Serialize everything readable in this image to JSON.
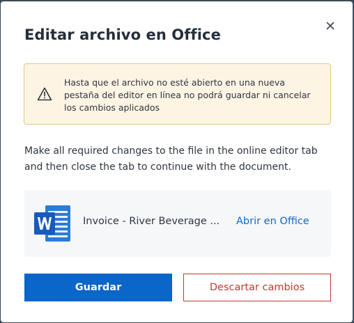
{
  "dialog": {
    "title": "Editar archivo en Office",
    "close_icon": "close-icon",
    "warning": {
      "icon": "warning-triangle-icon",
      "text": "Hasta que el archivo no esté abierto en una nueva pestaña del editor en línea no podrá guardar ni cancelar los cambios aplicados",
      "background": "#fdf4e3",
      "border": "#e6c680"
    },
    "description": "Make all required changes to the file in the online editor tab and then close the tab to continue with the document.",
    "file": {
      "icon": "word-document-icon",
      "name": "Invoice - River Beverage ...",
      "open_link": "Abrir en Office"
    },
    "buttons": {
      "save_label": "Guardar",
      "discard_label": "Descartar cambios"
    },
    "colors": {
      "primary": "#0a66c9",
      "danger": "#c0392b",
      "link": "#1467c3",
      "word": "#2b7cd3"
    }
  }
}
